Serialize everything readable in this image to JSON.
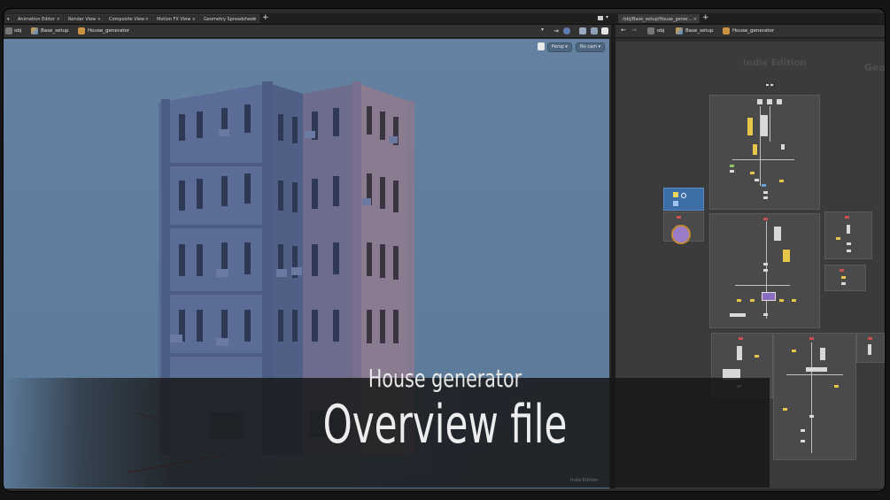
{
  "tabs_left": [
    {
      "label": "Animation Editor"
    },
    {
      "label": "Render View"
    },
    {
      "label": "Composite View"
    },
    {
      "label": "Motion FX View"
    },
    {
      "label": "Geometry Spreadsheet"
    }
  ],
  "tab_right": {
    "label": "/obj/Base_setup/House_gener..."
  },
  "path_left": {
    "root": "obj",
    "level1": "Base_setup",
    "level2": "House_generator"
  },
  "path_right": {
    "root": "obj",
    "level1": "Base_setup",
    "level2": "House_generator"
  },
  "viewport": {
    "persp_label": "Persp",
    "camera_label": "No cam"
  },
  "network": {
    "watermark": "Indie Edition",
    "context_label": "Geor"
  },
  "overlay": {
    "subtitle": "House generator",
    "title": "Overview file"
  },
  "viewport_watermark": "Indie Edition",
  "colors": {
    "viewport_bg": "#6481a1",
    "network_bg": "#3b3b3b",
    "building": "#5f6f97"
  }
}
